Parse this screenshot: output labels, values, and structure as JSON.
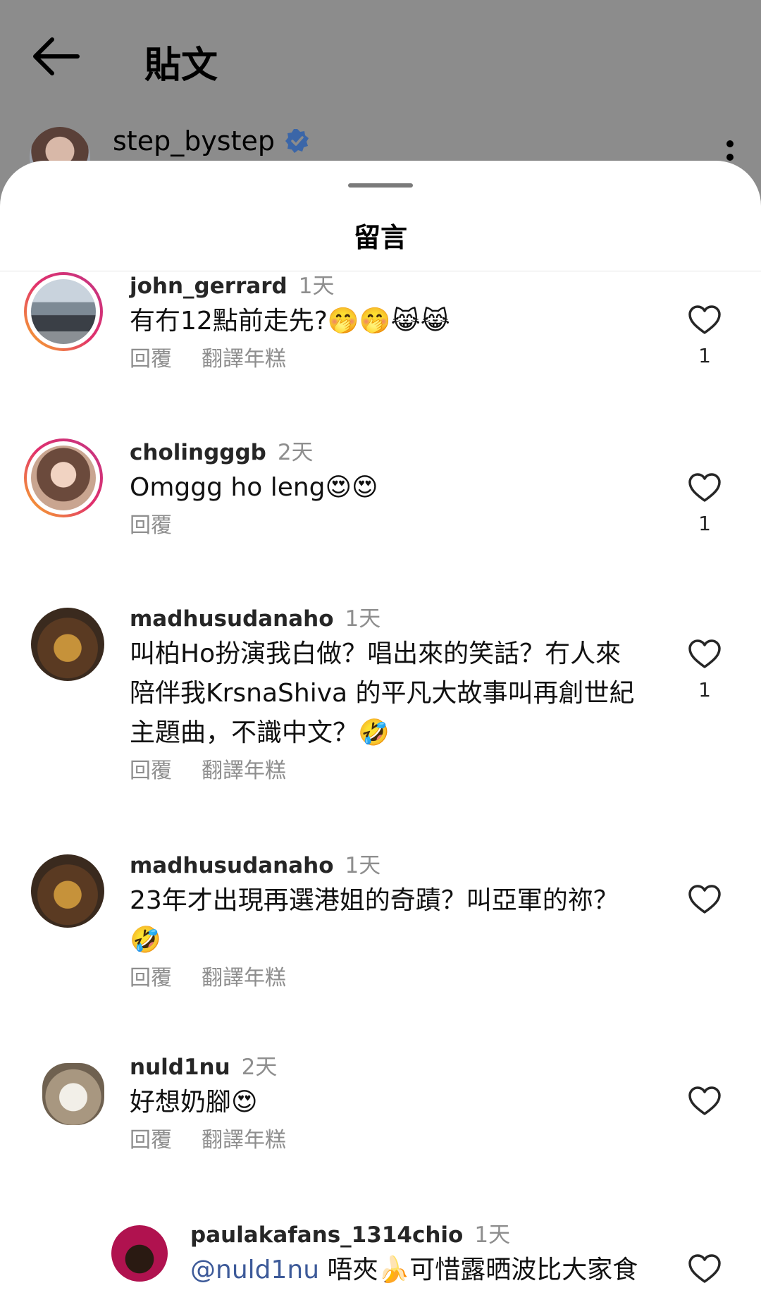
{
  "header": {
    "title": "貼文"
  },
  "post": {
    "username": "step_bystep"
  },
  "sheet": {
    "title": "留言"
  },
  "comments": [
    {
      "username": "john_gerrard",
      "time": "1天",
      "text": "有冇12點前走先?🤭🤭😹😹",
      "reply": "回覆",
      "translate": "翻譯年糕",
      "likes": "1"
    },
    {
      "username": "cholingggb",
      "time": "2天",
      "text": "Omggg ho leng😍😍",
      "reply": "回覆",
      "translate": "",
      "likes": "1"
    },
    {
      "username": "madhusudanaho",
      "time": "1天",
      "text": "叫柏Ho扮演我白做？唱出來的笑話？冇人來\n陪伴我KrsnaShiva 的平凡大故事叫再創世紀\n主題曲，不識中文？🤣",
      "reply": "回覆",
      "translate": "翻譯年糕",
      "likes": "1"
    },
    {
      "username": "madhusudanaho",
      "time": "1天",
      "text": "23年才出現再選港姐的奇蹟？叫亞軍的祢？\n🤣",
      "reply": "回覆",
      "translate": "翻譯年糕",
      "likes": ""
    },
    {
      "username": "nuld1nu",
      "time": "2天",
      "text": "好想奶腳😍",
      "reply": "回覆",
      "translate": "翻譯年糕",
      "likes": ""
    },
    {
      "username": "paulakafans_1314chio",
      "time": "1天",
      "mention": "@nuld1nu",
      "text": " 唔夾🍌可惜露晒波比大家食",
      "reply": "",
      "translate": "",
      "likes": ""
    }
  ],
  "icons": {
    "back": "arrow-left-icon",
    "verified": "verified-badge-icon",
    "more": "more-vertical-icon",
    "like": "heart-outline-icon"
  }
}
